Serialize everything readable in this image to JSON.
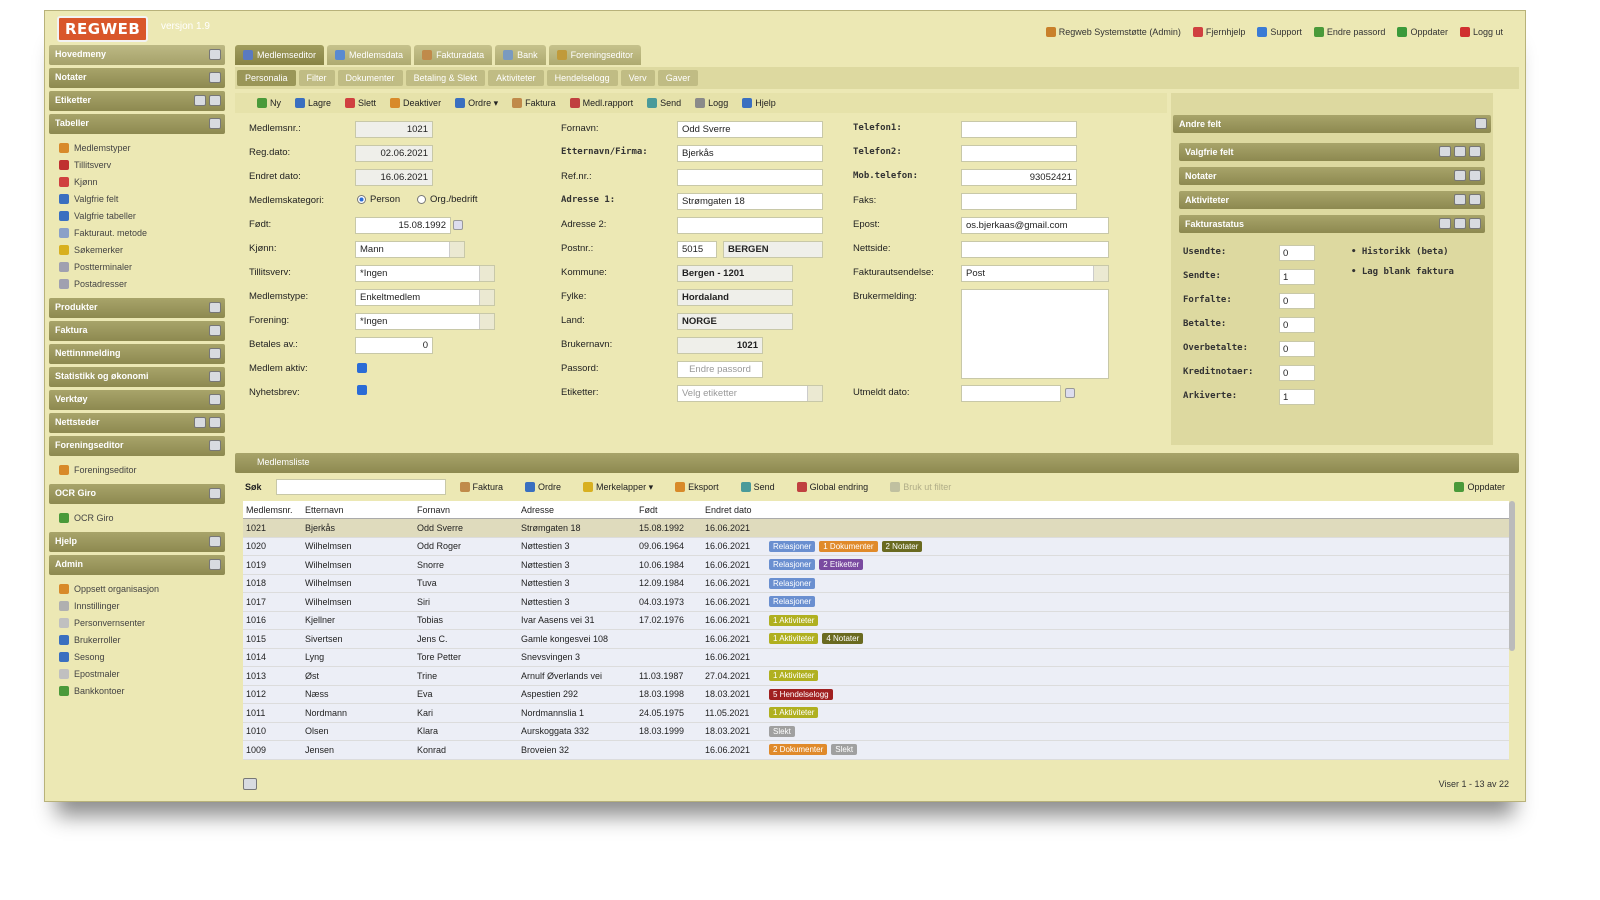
{
  "app": {
    "logo": "REGWEB",
    "version": "versjon 1.9"
  },
  "toplinks": [
    {
      "label": "Regweb Systemstøtte (Admin)",
      "icon": "user-icon",
      "color": "#c9802a"
    },
    {
      "label": "Fjernhjelp",
      "icon": "lifebuoy-icon",
      "color": "#d04040"
    },
    {
      "label": "Support",
      "icon": "support-icon",
      "color": "#3a7bd5"
    },
    {
      "label": "Endre passord",
      "icon": "key-icon",
      "color": "#4a9a3a"
    },
    {
      "label": "Oppdater",
      "icon": "refresh-icon",
      "color": "#3a9a3a"
    },
    {
      "label": "Logg ut",
      "icon": "logout-icon",
      "color": "#d03030"
    }
  ],
  "sidebar": {
    "main_menu": "Hovedmeny",
    "notes": "Notater",
    "labels": "Etiketter",
    "tables": "Tabeller",
    "table_items": [
      {
        "label": "Medlemstyper",
        "color": "#d88a2a"
      },
      {
        "label": "Tillitsverv",
        "color": "#c03030"
      },
      {
        "label": "Kjønn",
        "color": "#d04040"
      },
      {
        "label": "Valgfrie felt",
        "color": "#3a6fc0"
      },
      {
        "label": "Valgfrie tabeller",
        "color": "#3a6fc0"
      },
      {
        "label": "Fakturaut. metode",
        "color": "#8aa0c8"
      },
      {
        "label": "Søkemerker",
        "color": "#d8b020"
      },
      {
        "label": "Postterminaler",
        "color": "#a0a0b0"
      },
      {
        "label": "Postadresser",
        "color": "#a0a0b0"
      }
    ],
    "sections_a": [
      "Produkter",
      "Faktura",
      "Nettinnmelding",
      "Statistikk og økonomi",
      "Verktøy",
      "Nettsteder",
      "Foreningseditor"
    ],
    "foreningseditor_item": "Foreningseditor",
    "ocr_head": "OCR Giro",
    "ocr_item": "OCR Giro",
    "help_head": "Hjelp",
    "admin_head": "Admin",
    "admin_items": [
      {
        "label": "Oppsett organisasjon",
        "color": "#d88a2a"
      },
      {
        "label": "Innstillinger",
        "color": "#b0b0b0"
      },
      {
        "label": "Personvernsenter",
        "color": "#c0c0c0"
      },
      {
        "label": "Brukerroller",
        "color": "#3a6fc0"
      },
      {
        "label": "Sesong",
        "color": "#3a6fc0"
      },
      {
        "label": "Epostmaler",
        "color": "#c0c0c0"
      },
      {
        "label": "Bankkontoer",
        "color": "#4a9a3a"
      }
    ]
  },
  "tabs": [
    "Medlemseditor",
    "Medlemsdata",
    "Fakturadata",
    "Bank",
    "Foreningseditor"
  ],
  "subtabs": [
    "Personalia",
    "Filter",
    "Dokumenter",
    "Betaling & Slekt",
    "Aktiviteter",
    "Hendelselogg",
    "Verv",
    "Gaver"
  ],
  "toolbar": [
    "Ny",
    "Lagre",
    "Slett",
    "Deaktiver",
    "Ordre ▾",
    "Faktura",
    "Medl.rapport",
    "Send",
    "Logg",
    "Hjelp"
  ],
  "form": {
    "medlemsnr_label": "Medlemsnr.:",
    "medlemsnr": "1021",
    "regdato_label": "Reg.dato:",
    "regdato": "02.06.2021",
    "endret_label": "Endret dato:",
    "endret": "16.06.2021",
    "kategori_label": "Medlemskategori:",
    "kat_person": "Person",
    "kat_org": "Org./bedrift",
    "fodt_label": "Født:",
    "fodt": "15.08.1992",
    "kjonn_label": "Kjønn:",
    "kjonn": "Mann",
    "tillitsverv_label": "Tillitsverv:",
    "tillitsverv": "*Ingen",
    "medlemstype_label": "Medlemstype:",
    "medlemstype": "Enkeltmedlem",
    "forening_label": "Forening:",
    "forening": "*Ingen",
    "betales_label": "Betales av.:",
    "betales": "0",
    "aktiv_label": "Medlem aktiv:",
    "nyhetsbrev_label": "Nyhetsbrev:",
    "fornavn_label": "Fornavn:",
    "fornavn": "Odd Sverre",
    "etternavn_label": "Etternavn/Firma:",
    "etternavn": "Bjerkås",
    "refnr_label": "Ref.nr.:",
    "adresse1_label": "Adresse 1:",
    "adresse1": "Strømgaten 18",
    "adresse2_label": "Adresse 2:",
    "postnr_label": "Postnr.:",
    "postnr": "5015",
    "poststed": "BERGEN",
    "kommune_label": "Kommune:",
    "kommune": "Bergen - 1201",
    "fylke_label": "Fylke:",
    "fylke": "Hordaland",
    "land_label": "Land:",
    "land": "NORGE",
    "brukernavn_label": "Brukernavn:",
    "brukernavn": "1021",
    "passord_label": "Passord:",
    "passord_placeholder": "Endre passord",
    "etiketter_label": "Etiketter:",
    "etiketter_placeholder": "Velg etiketter",
    "tlf1_label": "Telefon1:",
    "tlf2_label": "Telefon2:",
    "mobil_label": "Mob.telefon:",
    "mobil": "93052421",
    "faks_label": "Faks:",
    "epost_label": "Epost:",
    "epost": "os.bjerkaas@gmail.com",
    "nettside_label": "Nettside:",
    "fakturautsendelse_label": "Fakturautsendelse:",
    "fakturautsendelse": "Post",
    "brukermelding_label": "Brukermelding:",
    "utmeldt_label": "Utmeldt dato:"
  },
  "right_panel": {
    "title": "Andre felt",
    "sections": [
      "Valgfrie felt",
      "Notater",
      "Aktiviteter",
      "Fakturastatus"
    ],
    "stats": [
      {
        "label": "Usendte:",
        "value": "0"
      },
      {
        "label": "Sendte:",
        "value": "1"
      },
      {
        "label": "Forfalte:",
        "value": "0"
      },
      {
        "label": "Betalte:",
        "value": "0"
      },
      {
        "label": "Overbetalte:",
        "value": "0"
      },
      {
        "label": "Kreditnotaer:",
        "value": "0"
      },
      {
        "label": "Arkiverte:",
        "value": "1"
      }
    ],
    "links": [
      "• Historikk (beta)",
      "• Lag blank faktura"
    ]
  },
  "memberlist": {
    "title": "Medlemsliste",
    "search_label": "Søk",
    "tools": [
      "Faktura",
      "Ordre",
      "Merkelapper ▾",
      "Eksport",
      "Send",
      "Global endring",
      "Bruk ut filter"
    ],
    "refresh": "Oppdater",
    "columns": [
      "Medlemsnr.",
      "Etternavn",
      "Fornavn",
      "Adresse",
      "Født",
      "Endret dato"
    ],
    "rows": [
      {
        "nr": "1021",
        "etternavn": "Bjerkås",
        "fornavn": "Odd Sverre",
        "adresse": "Strømgaten 18",
        "fodt": "15.08.1992",
        "endret": "16.06.2021",
        "tags": []
      },
      {
        "nr": "1020",
        "etternavn": "Wilhelmsen",
        "fornavn": "Odd Roger",
        "adresse": "Nøttestien 3",
        "fodt": "09.06.1964",
        "endret": "16.06.2021",
        "tags": [
          {
            "t": "Relasjoner",
            "c": "#6a8fd0"
          },
          {
            "t": "1 Dokumenter",
            "c": "#e08a2a"
          },
          {
            "t": "2 Notater",
            "c": "#6a6a20"
          }
        ]
      },
      {
        "nr": "1019",
        "etternavn": "Wilhelmsen",
        "fornavn": "Snorre",
        "adresse": "Nøttestien 3",
        "fodt": "10.06.1984",
        "endret": "16.06.2021",
        "tags": [
          {
            "t": "Relasjoner",
            "c": "#6a8fd0"
          },
          {
            "t": "2 Etiketter",
            "c": "#7a4aa0"
          }
        ]
      },
      {
        "nr": "1018",
        "etternavn": "Wilhelmsen",
        "fornavn": "Tuva",
        "adresse": "Nøttestien 3",
        "fodt": "12.09.1984",
        "endret": "16.06.2021",
        "tags": [
          {
            "t": "Relasjoner",
            "c": "#6a8fd0"
          }
        ]
      },
      {
        "nr": "1017",
        "etternavn": "Wilhelmsen",
        "fornavn": "Siri",
        "adresse": "Nøttestien 3",
        "fodt": "04.03.1973",
        "endret": "16.06.2021",
        "tags": [
          {
            "t": "Relasjoner",
            "c": "#6a8fd0"
          }
        ]
      },
      {
        "nr": "1016",
        "etternavn": "Kjellner",
        "fornavn": "Tobias",
        "adresse": "Ivar Aasens vei 31",
        "fodt": "17.02.1976",
        "endret": "16.06.2021",
        "tags": [
          {
            "t": "1 Aktiviteter",
            "c": "#b0b020"
          }
        ]
      },
      {
        "nr": "1015",
        "etternavn": "Sivertsen",
        "fornavn": "Jens C.",
        "adresse": "Gamle kongesvei 108",
        "fodt": "",
        "endret": "16.06.2021",
        "tags": [
          {
            "t": "1 Aktiviteter",
            "c": "#b0b020"
          },
          {
            "t": "4 Notater",
            "c": "#6a6a20"
          }
        ]
      },
      {
        "nr": "1014",
        "etternavn": "Lyng",
        "fornavn": "Tore Petter",
        "adresse": "Snevsvingen 3",
        "fodt": "",
        "endret": "16.06.2021",
        "tags": []
      },
      {
        "nr": "1013",
        "etternavn": "Øst",
        "fornavn": "Trine",
        "adresse": "Arnulf Øverlands vei",
        "fodt": "11.03.1987",
        "endret": "27.04.2021",
        "tags": [
          {
            "t": "1 Aktiviteter",
            "c": "#b0b020"
          }
        ]
      },
      {
        "nr": "1012",
        "etternavn": "Næss",
        "fornavn": "Eva",
        "adresse": "Aspestien 292",
        "fodt": "18.03.1998",
        "endret": "18.03.2021",
        "tags": [
          {
            "t": "5 Hendelselogg",
            "c": "#a02020"
          }
        ]
      },
      {
        "nr": "1011",
        "etternavn": "Nordmann",
        "fornavn": "Kari",
        "adresse": "Nordmannslia 1",
        "fodt": "24.05.1975",
        "endret": "11.05.2021",
        "tags": [
          {
            "t": "1 Aktiviteter",
            "c": "#b0b020"
          }
        ]
      },
      {
        "nr": "1010",
        "etternavn": "Olsen",
        "fornavn": "Klara",
        "adresse": "Aurskoggata 332",
        "fodt": "18.03.1999",
        "endret": "18.03.2021",
        "tags": [
          {
            "t": "Slekt",
            "c": "#a0a0a0"
          }
        ]
      },
      {
        "nr": "1009",
        "etternavn": "Jensen",
        "fornavn": "Konrad",
        "adresse": "Broveien 32",
        "fodt": "",
        "endret": "16.06.2021",
        "tags": [
          {
            "t": "2 Dokumenter",
            "c": "#e08a2a"
          },
          {
            "t": "Slekt",
            "c": "#a0a0a0"
          }
        ]
      }
    ],
    "footer": "Viser 1 - 13 av 22"
  }
}
